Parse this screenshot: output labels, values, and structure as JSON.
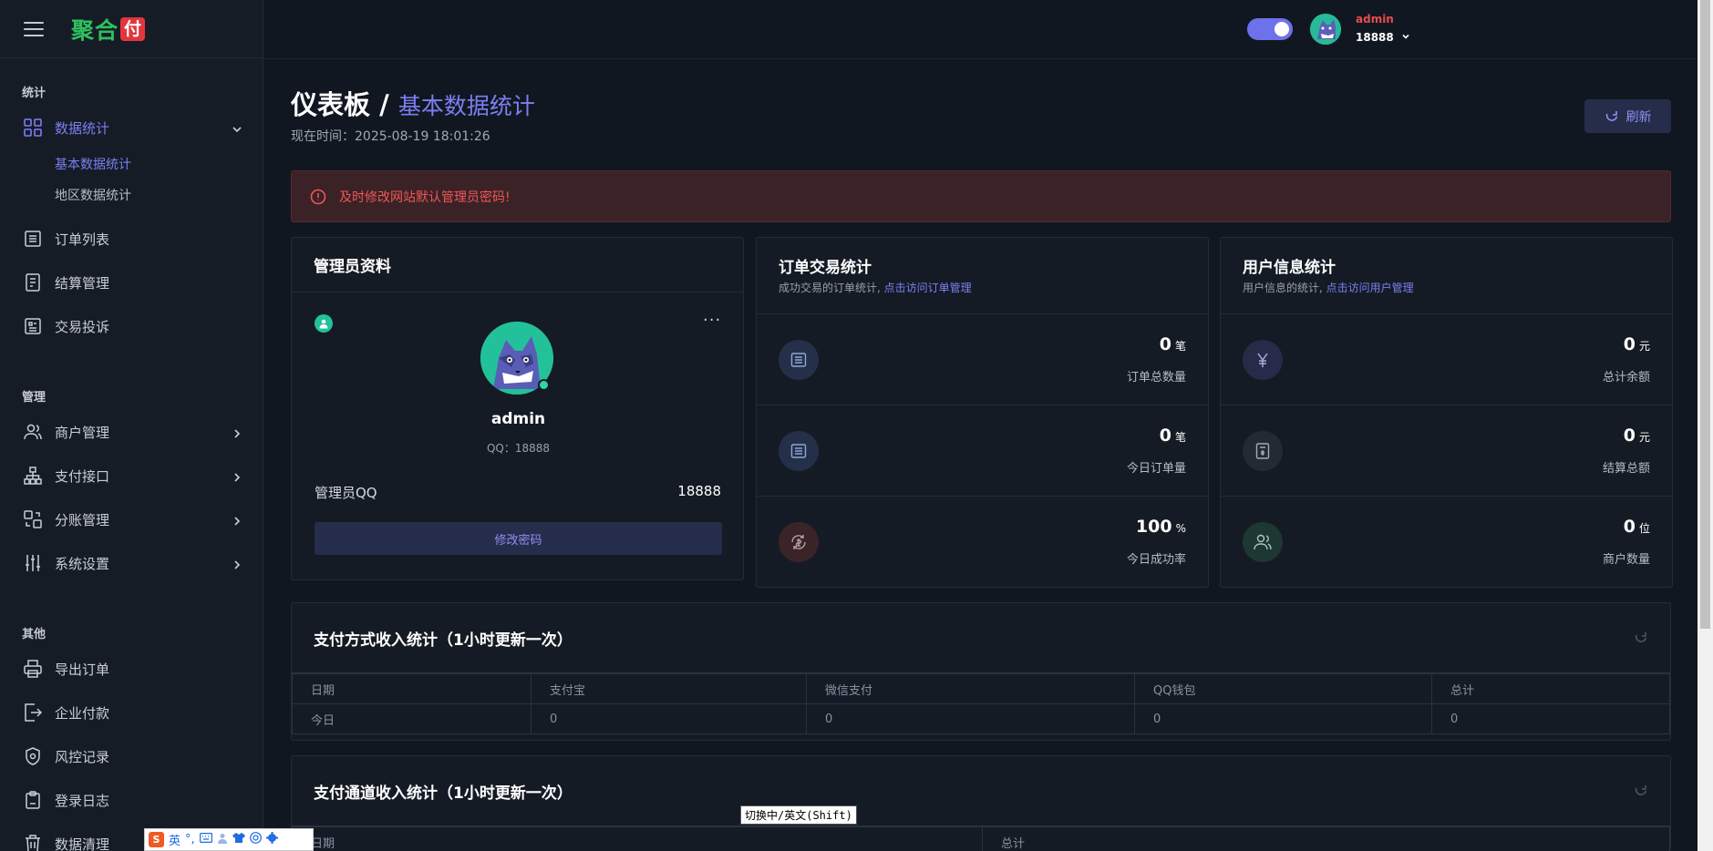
{
  "brand": {
    "name": "聚合",
    "badge": "付"
  },
  "header": {
    "user_name": "admin",
    "user_id": "18888",
    "theme_toggle": "on"
  },
  "sidebar": {
    "sections": [
      {
        "title": "统计"
      },
      {
        "title": "管理"
      },
      {
        "title": "其他"
      }
    ],
    "items": {
      "data_stats": "数据统计",
      "basic_stats": "基本数据统计",
      "region_stats": "地区数据统计",
      "orders": "订单列表",
      "settlement": "结算管理",
      "complaints": "交易投诉",
      "merchants": "商户管理",
      "payment_api": "支付接口",
      "split": "分账管理",
      "settings": "系统设置",
      "export": "导出订单",
      "enterprise_pay": "企业付款",
      "risk": "风控记录",
      "login_log": "登录日志",
      "cleanup": "数据清理"
    }
  },
  "page": {
    "title": "仪表板",
    "separator": " / ",
    "subtitle": "基本数据统计",
    "now_label": "现在时间：2025-08-19 18:01:26",
    "refresh": "刷新",
    "alert": "及时修改网站默认管理员密码!"
  },
  "admin_card": {
    "title": "管理员资料",
    "name": "admin",
    "qq_line": "QQ：18888",
    "kv_label": "管理员QQ",
    "kv_value": "18888",
    "change_password": "修改密码",
    "more": "···"
  },
  "order_card": {
    "title": "订单交易统计",
    "sub_prefix": "成功交易的订单统计, ",
    "sub_link": "点击访问订单管理",
    "rows": [
      {
        "value": "0",
        "unit": "笔",
        "label": "订单总数量"
      },
      {
        "value": "0",
        "unit": "笔",
        "label": "今日订单量"
      },
      {
        "value": "100",
        "unit": "%",
        "label": "今日成功率"
      }
    ]
  },
  "user_card": {
    "title": "用户信息统计",
    "sub_prefix": "用户信息的统计, ",
    "sub_link": "点击访问用户管理",
    "rows": [
      {
        "value": "0",
        "unit": "元",
        "label": "总计余额"
      },
      {
        "value": "0",
        "unit": "元",
        "label": "结算总额"
      },
      {
        "value": "0",
        "unit": "位",
        "label": "商户数量"
      }
    ]
  },
  "pay_method_table": {
    "title": "支付方式收入统计（1小时更新一次）",
    "headers": [
      "日期",
      "支付宝",
      "微信支付",
      "QQ钱包",
      "总计"
    ],
    "rows": [
      [
        "今日",
        "0",
        "0",
        "0",
        "0"
      ]
    ]
  },
  "pay_channel_table": {
    "title": "支付通道收入统计（1小时更新一次）",
    "headers": [
      "日期",
      "总计"
    ]
  },
  "ime": {
    "logo": "S",
    "mode": "英",
    "tooltip": "切换中/英文(Shift)"
  },
  "colors": {
    "accent": "#7b7ff2",
    "alert": "#ef5757",
    "success": "#2fd6a5",
    "brand_green": "#2fc05e",
    "brand_red": "#e2363d"
  }
}
